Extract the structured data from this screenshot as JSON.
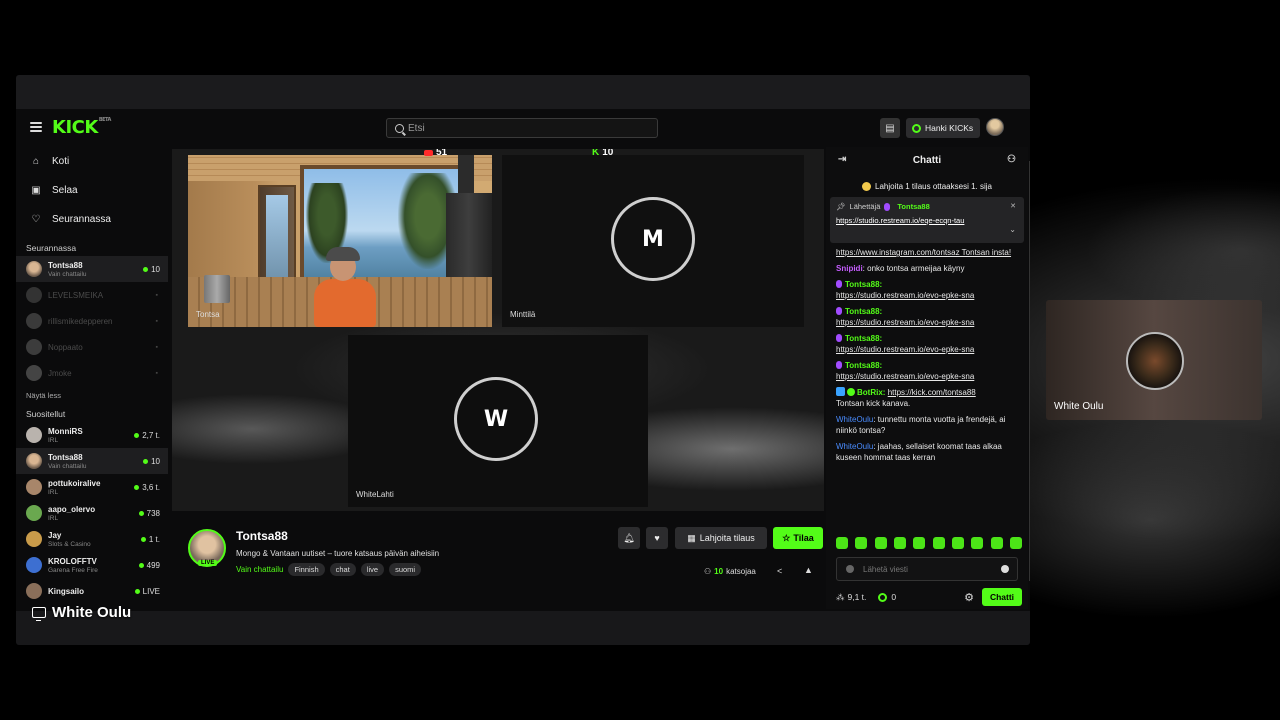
{
  "header": {
    "logo": "KICK",
    "logo_sup": "BETA",
    "search_placeholder": "Etsi",
    "get_kicks_label": "Hanki KICKs"
  },
  "sidebar": {
    "nav": [
      {
        "label": "Koti",
        "icon": "home-icon"
      },
      {
        "label": "Selaa",
        "icon": "browse-icon"
      },
      {
        "label": "Seurannassa",
        "icon": "heart-icon"
      }
    ],
    "following_heading": "Seurannassa",
    "following": [
      {
        "name": "Tontsa88",
        "sub": "Vain chattailu",
        "count": "10",
        "live": true
      },
      {
        "name": "LEVELSMEIKA",
        "sub": "",
        "count": "",
        "live": false
      },
      {
        "name": "rillismikedepperen",
        "sub": "",
        "count": "",
        "live": false
      },
      {
        "name": "Noppaato",
        "sub": "",
        "count": "",
        "live": false
      },
      {
        "name": "Jmoke",
        "sub": "",
        "count": "",
        "live": false
      }
    ],
    "show_less": "Näytä less",
    "recommended_heading": "Suositellut",
    "recommended": [
      {
        "name": "MonniRS",
        "sub": "IRL",
        "count": "2,7 t."
      },
      {
        "name": "Tontsa88",
        "sub": "Vain chattailu",
        "count": "10"
      },
      {
        "name": "pottukoiralive",
        "sub": "IRL",
        "count": "3,6 t."
      },
      {
        "name": "aapo_olervo",
        "sub": "IRL",
        "count": "738"
      },
      {
        "name": "Jay",
        "sub": "Slots & Casino",
        "count": "1 t."
      },
      {
        "name": "KROLOFFTV",
        "sub": "Garena Free Fire",
        "count": "499"
      },
      {
        "name": "Kingsailo",
        "sub": "",
        "count": "LIVE"
      }
    ]
  },
  "video": {
    "yt_viewers": "51",
    "kick_viewers": "10",
    "tiles": [
      {
        "label": "Tontsa",
        "initial": ""
      },
      {
        "label": "Minttilä",
        "initial": "M"
      },
      {
        "label": "WhiteLahti",
        "initial": "W"
      }
    ]
  },
  "stream": {
    "name": "Tontsa88",
    "live_badge": "LIVE",
    "title": "Mongo & Vantaan uutiset – tuore katsaus päivän aiheisiin",
    "category": "Vain chattailu",
    "tags": [
      "Finnish",
      "chat",
      "live",
      "suomi"
    ],
    "gift_label": "Lahjoita tilaus",
    "subscribe_label": "Tilaa",
    "viewer_count": "10",
    "viewer_word": "katsojaa"
  },
  "chat": {
    "title": "Chatti",
    "gift_banner": "Lahjoita 1 tilaus ottaaksesi 1. sija",
    "pinned_prefix": "Lähettäjä",
    "pinned_sender": "Tontsa88",
    "pinned_link": "https://studio.restream.io/eqe-ecqn-tau",
    "messages": [
      {
        "user": "",
        "text": "https://www.instagram.com/tontsaz Tontsan insta!"
      },
      {
        "user": "Snipidi",
        "text": ": onko tontsa armeijaa käyny"
      },
      {
        "user": "Tontsa88:",
        "text": "https://studio.restream.io/evo-epke-sna"
      },
      {
        "user": "Tontsa88:",
        "text": "https://studio.restream.io/evo-epke-sna"
      },
      {
        "user": "Tontsa88:",
        "text": "https://studio.restream.io/evo-epke-sna"
      },
      {
        "user": "Tontsa88:",
        "text": "https://studio.restream.io/evo-epke-sna"
      },
      {
        "user": "BotRix:",
        "link": "https://kick.com/tontsa88",
        "text": "Tontsan kick kanava."
      },
      {
        "user": "WhiteOulu",
        "text": ": tunnettu monta vuotta ja frendejä, ai niinkö tontsa?"
      },
      {
        "user": "WhiteOulu",
        "text": ": jaahas, sellaiset koomat taas alkaa kuseen hommat taas kerran"
      }
    ],
    "input_placeholder": "Lähetä viesti",
    "points": "9,1 t.",
    "kicks": "0",
    "chat_button": "Chatti"
  },
  "overlay": {
    "screen_share_label": "White Oulu",
    "side_participant": "White Oulu"
  },
  "colors": {
    "kick_green": "#53fc18",
    "mod_purple": "#c65dff",
    "user_blue": "#4a8cff"
  }
}
